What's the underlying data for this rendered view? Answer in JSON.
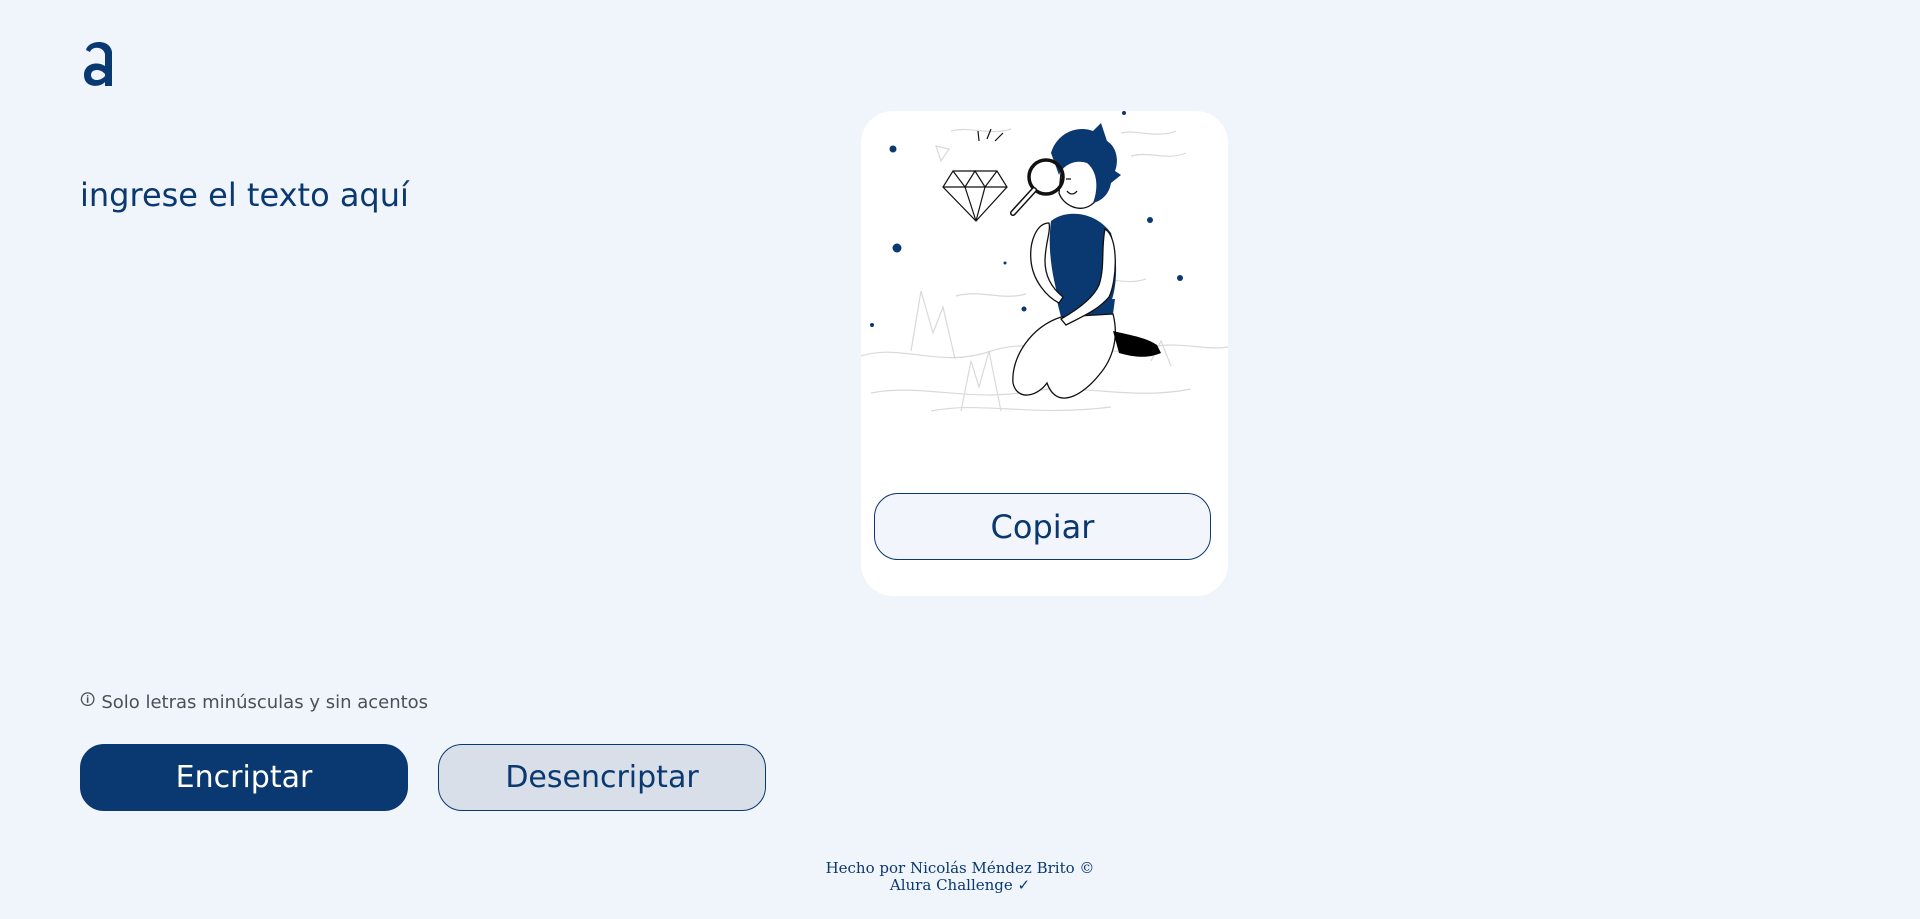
{
  "header": {
    "logo_icon": "alura-logo-icon"
  },
  "input": {
    "placeholder": "ingrese el texto aquí"
  },
  "hint": {
    "icon": "info-icon",
    "icon_glyph": "🛈",
    "text": "Solo letras minúsculas y sin acentos"
  },
  "buttons": {
    "encrypt": "Encriptar",
    "decrypt": "Desencriptar"
  },
  "output": {
    "illustration": "person-with-magnifier-illustration",
    "copy": "Copiar"
  },
  "footer": {
    "line1": "Hecho por Nicolás Méndez Brito ©",
    "line2": "Alura Challenge ✓"
  },
  "colors": {
    "primary": "#0a3871",
    "background": "#f0f4fb",
    "secondary_button": "#d8dfe8",
    "card": "#ffffff"
  }
}
